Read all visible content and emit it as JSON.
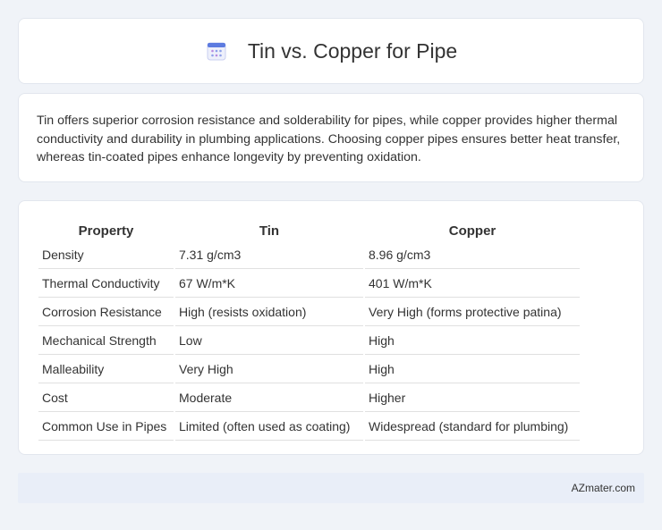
{
  "header": {
    "title": "Tin vs. Copper for Pipe",
    "icon": "calendar-icon"
  },
  "description": "Tin offers superior corrosion resistance and solderability for pipes, while copper provides higher thermal conductivity and durability in plumbing applications. Choosing copper pipes ensures better heat transfer, whereas tin-coated pipes enhance longevity by preventing oxidation.",
  "table": {
    "headers": [
      "Property",
      "Tin",
      "Copper"
    ],
    "rows": [
      [
        "Density",
        "7.31 g/cm3",
        "8.96 g/cm3"
      ],
      [
        "Thermal Conductivity",
        "67 W/m*K",
        "401 W/m*K"
      ],
      [
        "Corrosion Resistance",
        "High (resists oxidation)",
        "Very High (forms protective patina)"
      ],
      [
        "Mechanical Strength",
        "Low",
        "High"
      ],
      [
        "Malleability",
        "Very High",
        "High"
      ],
      [
        "Cost",
        "Moderate",
        "Higher"
      ],
      [
        "Common Use in Pipes",
        "Limited (often used as coating)",
        "Widespread (standard for plumbing)"
      ]
    ]
  },
  "footer": {
    "site": "AZmater.com"
  },
  "colors": {
    "background": "#f0f3f8",
    "footer_bg": "#e9eef8",
    "icon_accent": "#7b8fe6"
  }
}
